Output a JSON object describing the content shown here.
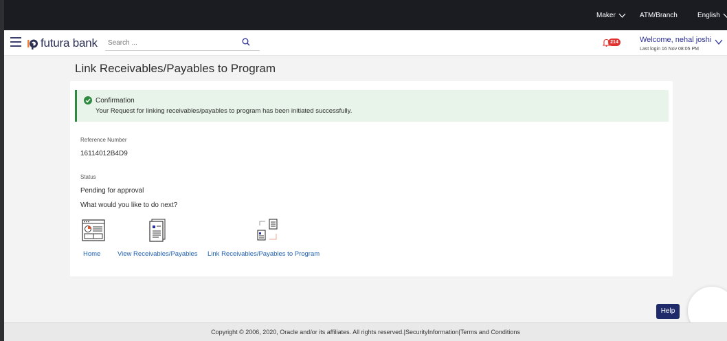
{
  "topbar": {
    "role_label": "Maker",
    "branch_label": "ATM/Branch",
    "language_label": "English"
  },
  "header": {
    "logo_text": "futura bank",
    "search_placeholder": "Search ...",
    "notification_count": "214",
    "welcome_text": "Welcome, nehal joshi",
    "last_login_text": "Last login 16 Nov 08:05 PM"
  },
  "page": {
    "title": "Link Receivables/Payables to Program",
    "confirmation": {
      "title": "Confirmation",
      "message": "Your Request for linking receivables/payables to program has been initiated successfully."
    },
    "reference_label": "Reference Number",
    "reference_value": "16114012B4D9",
    "status_label": "Status",
    "status_value": "Pending for approval",
    "next_prompt": "What would you like to do next?",
    "actions": [
      {
        "label": "Home",
        "icon": "dashboard-icon"
      },
      {
        "label": "View Receivables/Payables",
        "icon": "document-list-icon"
      },
      {
        "label": "Link Receivables/Payables to Program",
        "icon": "link-documents-icon"
      }
    ]
  },
  "footer": {
    "copyright_text": "Copyright © 2006, 2020, Oracle and/or its affiliates. All rights reserved.|SecurityInformation|Terms and Conditions"
  },
  "help_label": "Help",
  "colors": {
    "topbar_bg": "#1a1c22",
    "brand": "#2b2f52",
    "link": "#1d5fb1",
    "success_bg": "#e8f4ea",
    "success_accent": "#2d8a3e",
    "badge": "#e0322e",
    "help_bg": "#1f2a6b"
  }
}
